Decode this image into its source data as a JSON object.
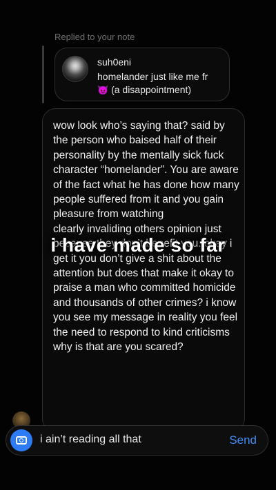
{
  "reply": {
    "label": "Replied to your note"
  },
  "note": {
    "username": "suh0eni",
    "text": "homelander just like me fr",
    "emoji": "😈",
    "suffix": " (a disappointment)"
  },
  "message": {
    "text": "wow look who’s saying that? said by the person who baised half of their personality by the mentally sick fuck character “homelander”. You are aware of the fact what he has done how many people suffered from it and you gain pleasure from watching\nclearly invaliding others opinion just because they don’t benefit you. okay i get it you don’t give a shit about the attention but does that make it okay to praise a man who committed homicide and thousands of other crimes? i know you see my message in reality you feel the need to respond to kind criticisms why is that are you scared?"
  },
  "overlay": {
    "caption": "i have made so far"
  },
  "composer": {
    "input_text": "i ain’t reading all that",
    "send_label": "Send",
    "camera_icon": "camera-icon",
    "accent": "#3f8cf7"
  }
}
